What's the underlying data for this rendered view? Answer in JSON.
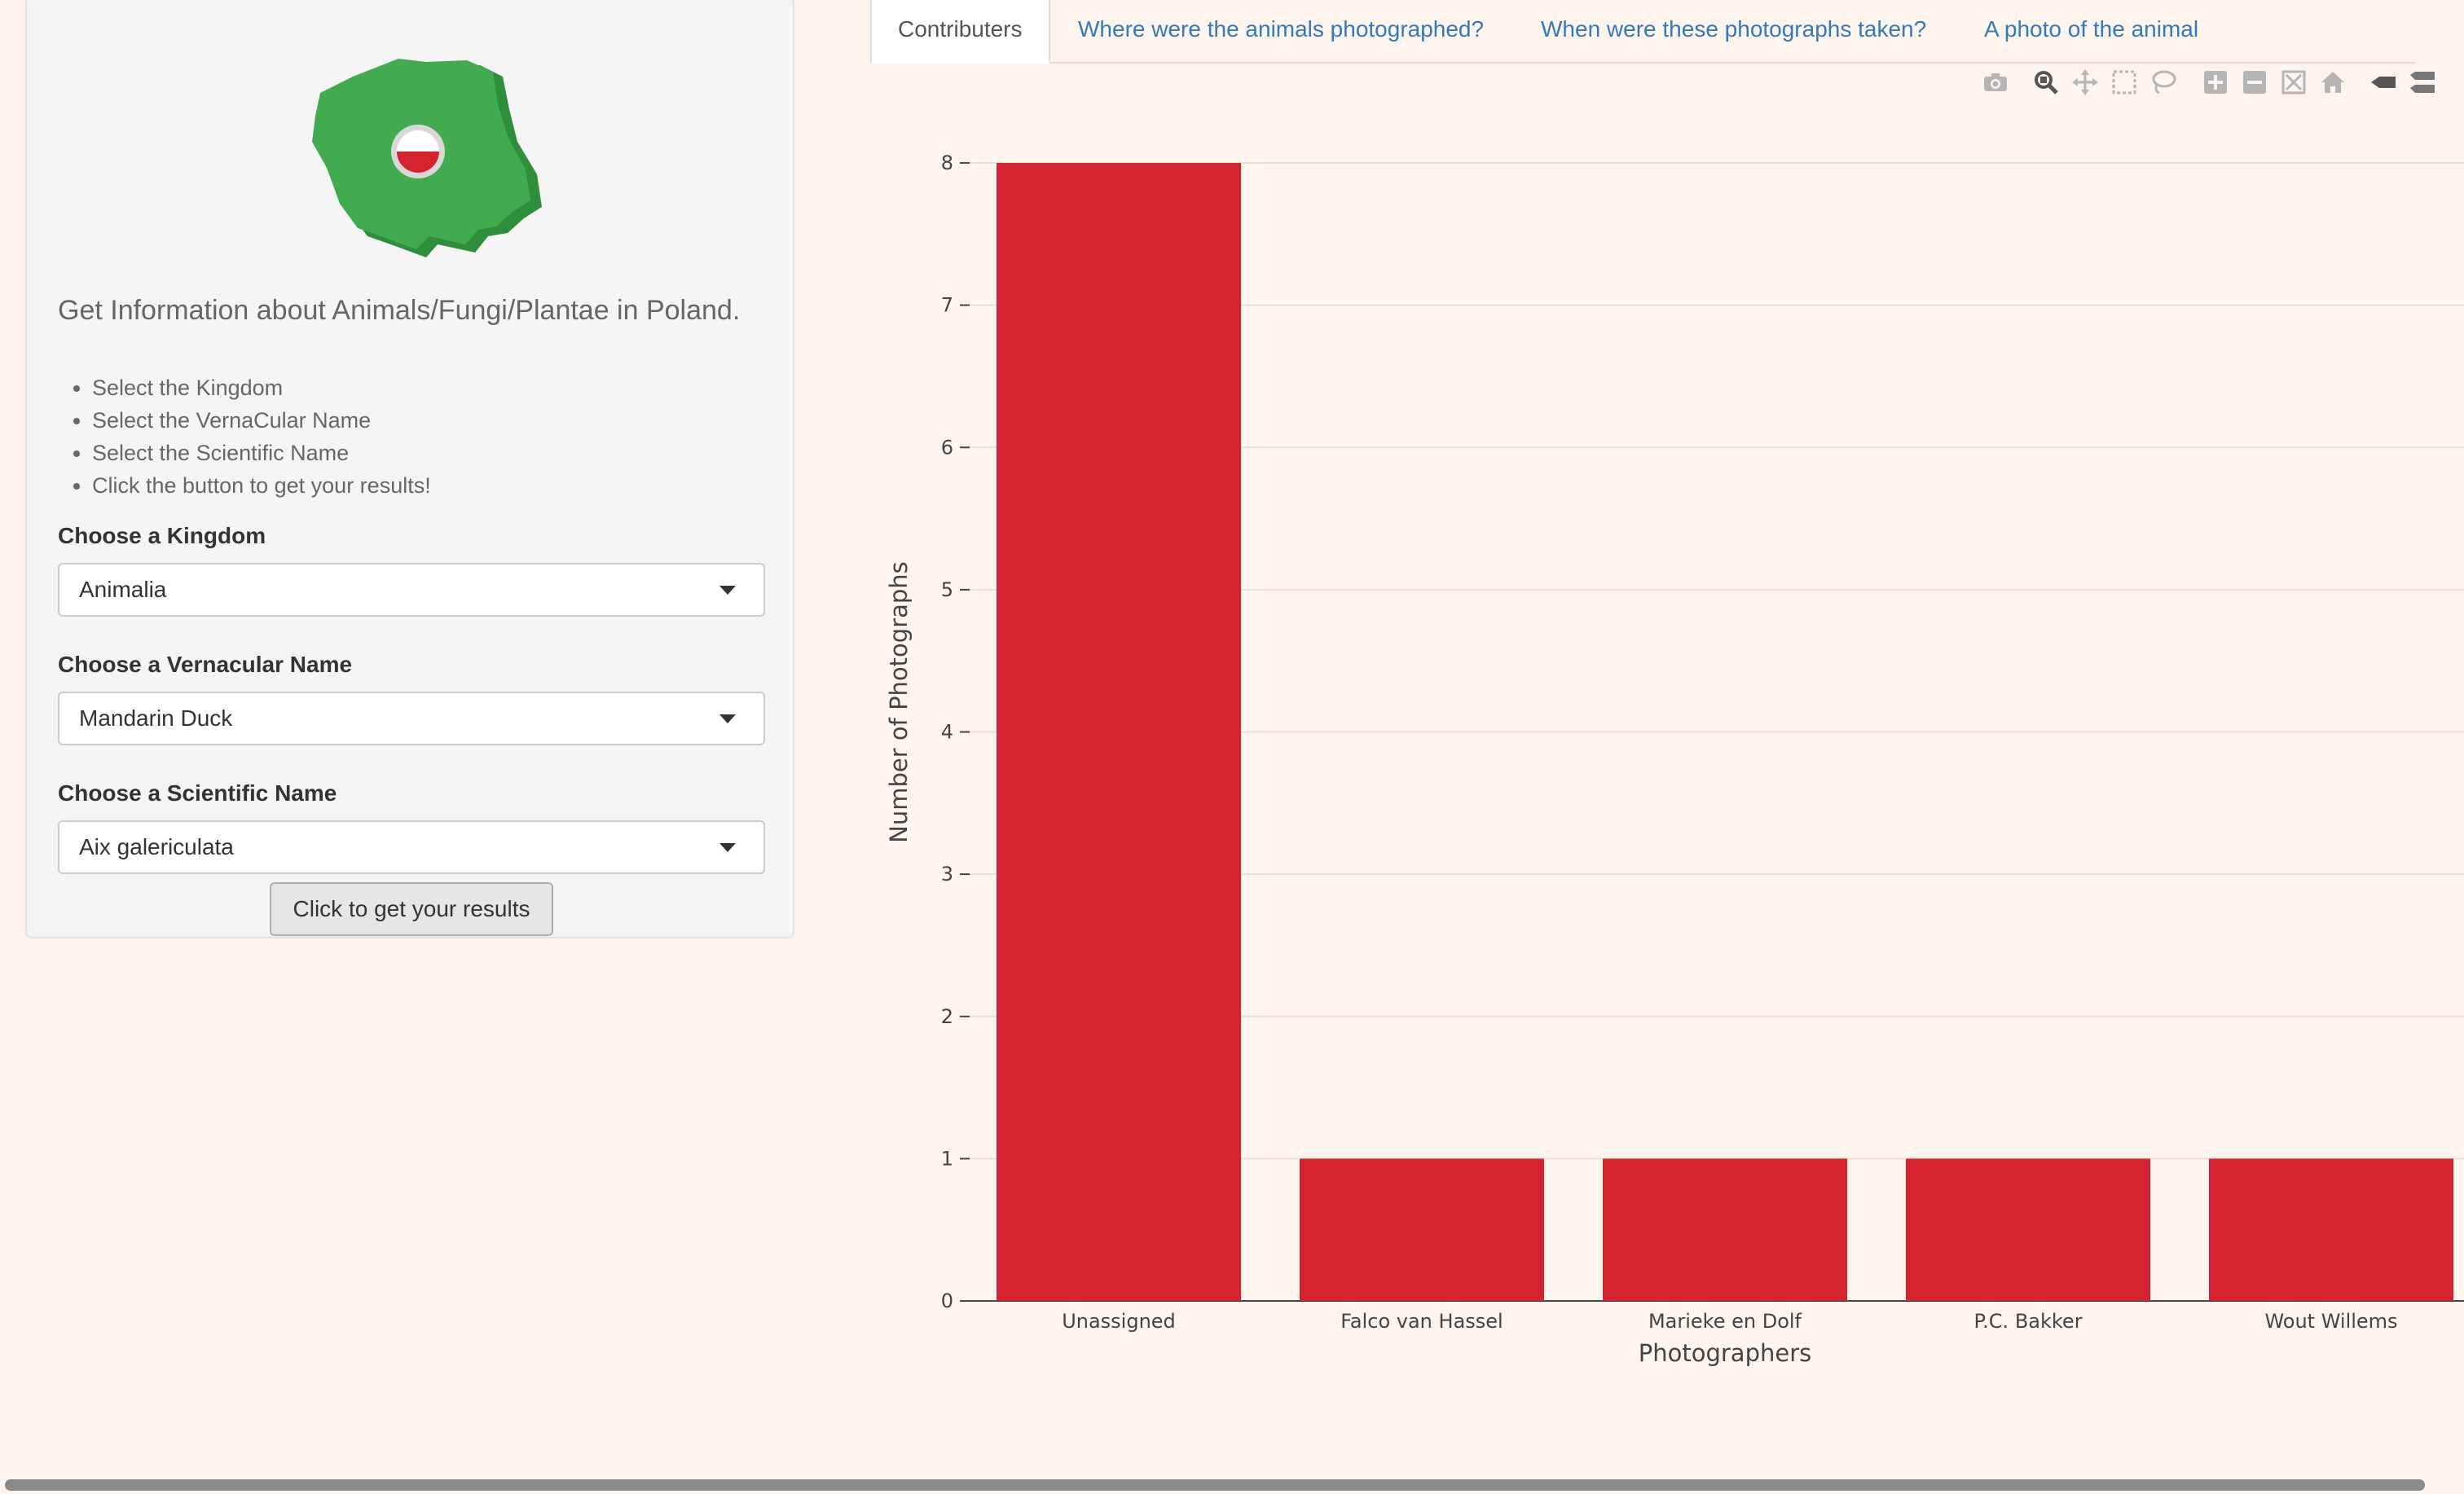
{
  "sidebar": {
    "headline": "Get Information about Animals/Fungi/Plantae in Poland.",
    "steps": [
      "Select the Kingdom",
      "Select the VernaCular Name",
      "Select the Scientific Name",
      "Click the button to get your results!"
    ],
    "kingdom": {
      "label": "Choose a Kingdom",
      "value": "Animalia"
    },
    "vernacular": {
      "label": "Choose a Vernacular Name",
      "value": "Mandarin Duck"
    },
    "scientific": {
      "label": "Choose a Scientific Name",
      "value": "Aix galericulata"
    },
    "button_label": "Click to get your results"
  },
  "tabs": [
    {
      "label": "Contributers",
      "active": true
    },
    {
      "label": "Where were the animals photographed?",
      "active": false
    },
    {
      "label": "When were these photographs taken?",
      "active": false
    },
    {
      "label": "A photo of the animal",
      "active": false
    }
  ],
  "modebar": [
    "camera-icon",
    "zoom-icon",
    "pan-icon",
    "box-select-icon",
    "lasso-icon",
    "zoom-in-icon",
    "zoom-out-icon",
    "autoscale-icon",
    "reset-axes-icon",
    "spike-lines-icon",
    "compare-hover-icon"
  ],
  "colors": {
    "bar": "#d3232f",
    "background": "#fdf4ee",
    "link": "#337ab7"
  },
  "chart_data": {
    "type": "bar",
    "categories": [
      "Unassigned",
      "Falco van Hassel",
      "Marieke en Dolf",
      "P.C. Bakker",
      "Wout Willems"
    ],
    "values": [
      8,
      1,
      1,
      1,
      1
    ],
    "xlabel": "Photographers",
    "ylabel": "Number of Photographs",
    "ylim": [
      0,
      8
    ],
    "yticks": [
      "0",
      "1",
      "2",
      "3",
      "4",
      "5",
      "6",
      "7",
      "8"
    ],
    "grid": true
  }
}
